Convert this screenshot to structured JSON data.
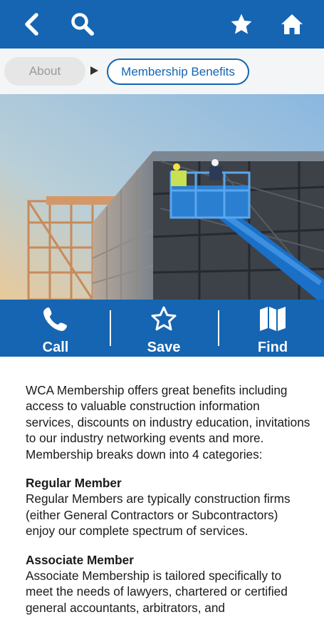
{
  "colors": {
    "primary": "#1565b2",
    "breadcrumb_bg": "#f4f5f6",
    "text": "#1a1a1a"
  },
  "topbar": {
    "icons": [
      "back-arrow-icon",
      "search-icon",
      "star-icon",
      "home-icon"
    ]
  },
  "breadcrumb": {
    "items": [
      {
        "label": "About",
        "state": "inactive"
      },
      {
        "label": "Membership Benefits",
        "state": "current"
      }
    ]
  },
  "hero": {
    "icon": "construction-site-photo"
  },
  "actions": [
    {
      "label": "Call",
      "icon": "phone-icon"
    },
    {
      "label": "Save",
      "icon": "star-outline-icon"
    },
    {
      "label": "Find",
      "icon": "map-icon"
    }
  ],
  "content": {
    "intro": "WCA Membership offers great benefits including access to valuable construction information services, discounts on industry education, invitations to our industry networking events and more. Membership breaks down into 4 categories:",
    "sections": [
      {
        "heading": "Regular Member",
        "body": "Regular Members are typically construction firms (either General Contractors or Subcontractors) enjoy our complete spectrum of services."
      },
      {
        "heading": "Associate Member",
        "body": "Associate Membership is tailored specifically to meet the needs of lawyers, chartered or certified general accountants, arbitrators, and"
      }
    ]
  }
}
